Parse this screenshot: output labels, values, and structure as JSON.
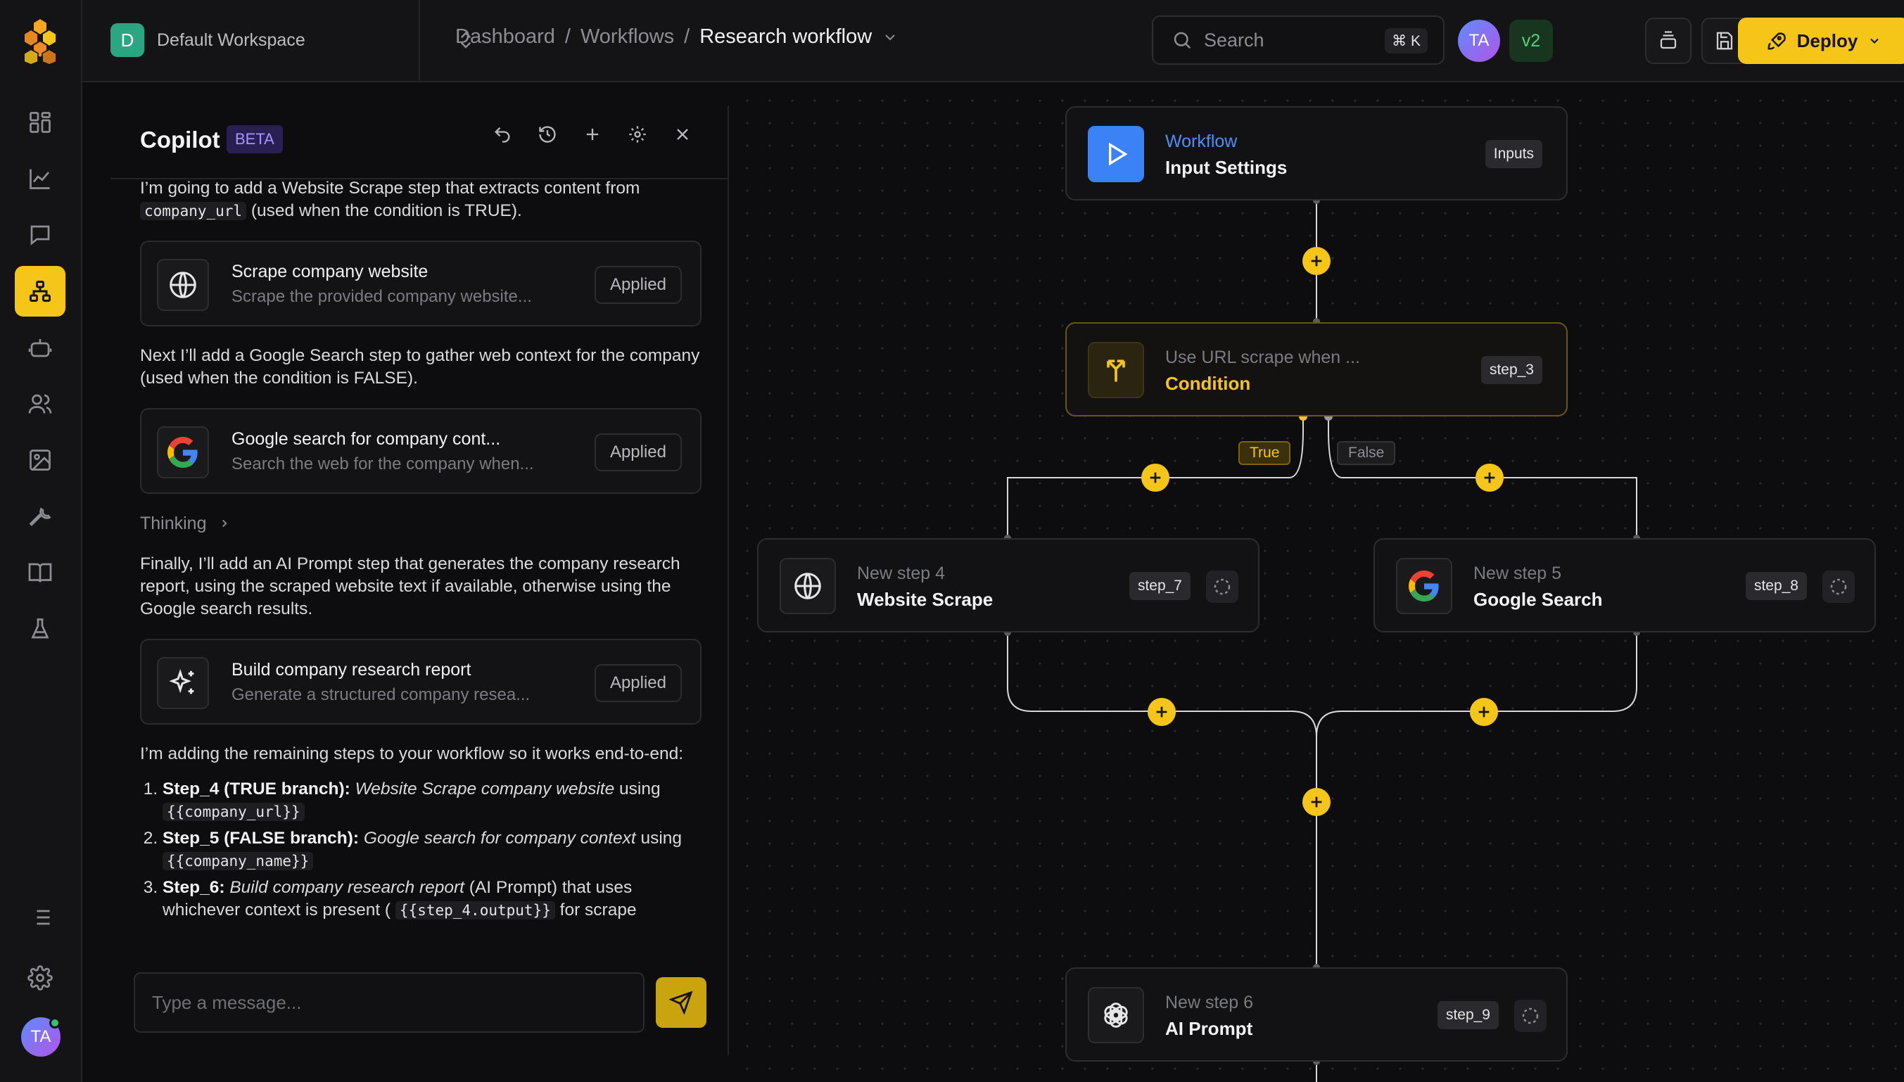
{
  "workspace": {
    "initial": "D",
    "name": "Default Workspace"
  },
  "breadcrumb": {
    "items": [
      "Dashboard",
      "Workflows"
    ],
    "current": "Research workflow",
    "sep": "/"
  },
  "search": {
    "placeholder": "Search",
    "shortcut": "⌘ K"
  },
  "user": {
    "initials": "TA"
  },
  "version": "v2",
  "deploy_label": "Deploy",
  "copilot": {
    "title": "Copilot",
    "badge": "BETA",
    "intro_1": "I’m going to add a Website Scrape step that extracts content from",
    "intro_1_code": "company_url",
    "intro_1_tail": "(used when the condition is TRUE).",
    "cards": [
      {
        "title": "Scrape company website",
        "subtitle": "Scrape the provided company website...",
        "status": "Applied",
        "icon": "globe-icon"
      },
      {
        "title": "Google search for company cont...",
        "subtitle": "Search the web for the company when...",
        "status": "Applied",
        "icon": "google-icon"
      },
      {
        "title": "Build company research report",
        "subtitle": "Generate a structured company resea...",
        "status": "Applied",
        "icon": "sparkles-icon"
      }
    ],
    "para_2": "Next I’ll add a Google Search step to gather web context for the company (used when the condition is FALSE).",
    "thinking": "Thinking",
    "para_3": "Finally, I’ll add an AI Prompt step that generates the company research report, using the scraped website text if available, otherwise using the Google search results.",
    "para_4": "I’m adding the remaining steps to your workflow so it works end-to-end:",
    "list": [
      {
        "lead": "Step_4 (TRUE branch):",
        "italic": "Website Scrape company website",
        "tail": "using",
        "code": "{{company_url}}"
      },
      {
        "lead": "Step_5 (FALSE branch):",
        "italic": "Google search for company context",
        "tail": "using",
        "code": "{{company_name}}"
      },
      {
        "lead": "Step_6:",
        "italic": "Build company research report",
        "tail": "(AI Prompt) that uses whichever context is present (",
        "code": "{{step_4.output}}",
        "tail2": "for scrape"
      }
    ],
    "composer_placeholder": "Type a message..."
  },
  "canvas": {
    "input_node": {
      "kind": "Workflow",
      "name": "Input Settings",
      "tag": "Inputs"
    },
    "condition_node": {
      "kind": "Use URL scrape when ...",
      "name": "Condition",
      "tag": "step_3"
    },
    "branch_true": "True",
    "branch_false": "False",
    "step4": {
      "kind": "New step 4",
      "name": "Website Scrape",
      "tag": "step_7"
    },
    "step5": {
      "kind": "New step 5",
      "name": "Google Search",
      "tag": "step_8"
    },
    "step6": {
      "kind": "New step 6",
      "name": "AI Prompt",
      "tag": "step_9"
    }
  },
  "colors": {
    "accent": "#f5c518",
    "workflow_blue": "#3b82f6",
    "condition_gold": "#f5c518"
  }
}
